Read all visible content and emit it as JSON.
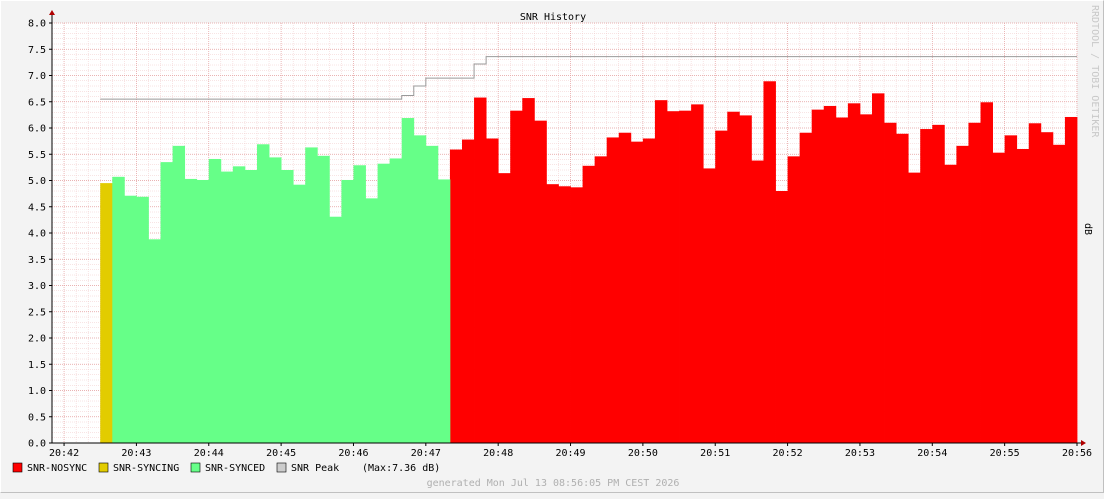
{
  "chart_data": {
    "type": "area",
    "title": "SNR History",
    "ylabel": "dB",
    "watermark": "RRDTOOL / TOBI OETIKER",
    "ylim": [
      0,
      8
    ],
    "yticks": [
      "0.0",
      "0.5",
      "1.0",
      "1.5",
      "2.0",
      "2.5",
      "3.0",
      "3.5",
      "4.0",
      "4.5",
      "5.0",
      "5.5",
      "6.0",
      "6.5",
      "7.0",
      "7.5",
      "8.0"
    ],
    "xlim": [
      "20:41:50",
      "20:56:00"
    ],
    "xticks": [
      "20:42",
      "20:43",
      "20:44",
      "20:45",
      "20:46",
      "20:47",
      "20:48",
      "20:49",
      "20:50",
      "20:51",
      "20:52",
      "20:53",
      "20:54",
      "20:55",
      "20:56"
    ],
    "grid": true,
    "step_seconds": 10,
    "start_time": "20:42:30",
    "series": [
      {
        "name": "SNR-NOSYNC",
        "color": "#ff0000",
        "start": "20:47:20",
        "values": [
          5.59,
          5.78,
          6.58,
          5.8,
          5.14,
          6.33,
          6.57,
          6.14,
          4.93,
          4.89,
          4.87,
          5.28,
          5.46,
          5.82,
          5.91,
          5.74,
          5.8,
          6.53,
          6.32,
          6.33,
          6.45,
          5.23,
          5.95,
          6.31,
          6.24,
          5.38,
          6.89,
          4.8,
          5.46,
          5.91,
          6.35,
          6.42,
          6.2,
          6.47,
          6.26,
          6.66,
          6.1,
          5.89,
          5.15,
          5.98,
          6.06,
          5.3,
          5.66,
          6.1,
          6.49,
          5.53,
          5.86,
          5.6,
          6.09,
          5.92,
          5.68,
          6.21
        ]
      },
      {
        "name": "SNR-SYNCING",
        "color": "#e2cc00",
        "start": "20:42:30",
        "values": [
          4.95
        ]
      },
      {
        "name": "SNR-SYNCED",
        "color": "#66ff88",
        "start": "20:42:40",
        "values": [
          5.07,
          4.71,
          4.69,
          3.88,
          5.35,
          5.66,
          5.03,
          5.01,
          5.41,
          5.17,
          5.27,
          5.2,
          5.69,
          5.44,
          5.2,
          4.92,
          5.63,
          5.47,
          4.31,
          5.01,
          5.29,
          4.66,
          5.32,
          5.42,
          6.19,
          5.86,
          5.66,
          5.02
        ]
      },
      {
        "name": "SNR Peak",
        "color": "#999999",
        "line": true,
        "points": [
          [
            "20:42:30",
            6.55
          ],
          [
            "20:46:40",
            6.55
          ],
          [
            "20:46:40",
            6.62
          ],
          [
            "20:46:50",
            6.62
          ],
          [
            "20:46:50",
            6.8
          ],
          [
            "20:47:00",
            6.8
          ],
          [
            "20:47:00",
            6.95
          ],
          [
            "20:47:40",
            6.95
          ],
          [
            "20:47:40",
            7.22
          ],
          [
            "20:47:50",
            7.22
          ],
          [
            "20:47:50",
            7.36
          ],
          [
            "20:56:00",
            7.36
          ]
        ]
      }
    ],
    "legend": {
      "placement": "bottom-left",
      "items": [
        {
          "label": "SNR-NOSYNC",
          "color": "#ff0000"
        },
        {
          "label": "SNR-SYNCING",
          "color": "#e2cc00"
        },
        {
          "label": "SNR-SYNCED",
          "color": "#66ff88"
        },
        {
          "label": "SNR Peak",
          "color": "#cccccc"
        }
      ],
      "peak_note": "(Max:7.36 dB)"
    },
    "footer": "generated Mon Jul 13 08:56:05 PM CEST 2026"
  }
}
